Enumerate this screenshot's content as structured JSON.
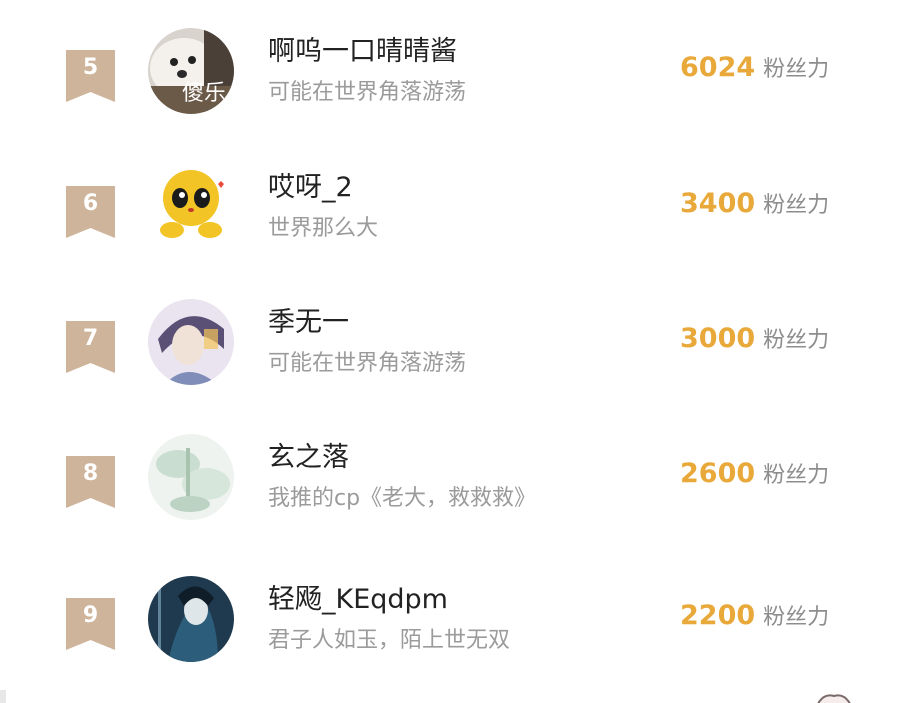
{
  "ranking": {
    "rows": [
      {
        "rank": "5",
        "name": "啊呜一口晴晴酱",
        "bio": "可能在世界角落游荡",
        "fans": "6024",
        "unit": "粉丝力",
        "avatar_overlay": "傻乐"
      },
      {
        "rank": "6",
        "name": "哎呀_2",
        "bio": "世界那么大",
        "fans": "3400",
        "unit": "粉丝力"
      },
      {
        "rank": "7",
        "name": "季无一",
        "bio": "可能在世界角落游荡",
        "fans": "3000",
        "unit": "粉丝力"
      },
      {
        "rank": "8",
        "name": "玄之落",
        "bio": "我推的cp《老大，救救救》",
        "fans": "2600",
        "unit": "粉丝力"
      },
      {
        "rank": "9",
        "name": "轻飏_KEqdpm",
        "bio": "君子人如玉，陌上世无双",
        "fans": "2200",
        "unit": "粉丝力"
      }
    ]
  },
  "colors": {
    "rank_badge": "#cdb49a",
    "fans_value": "#e9a93a",
    "name_text": "#222222",
    "bio_text": "#9b9b9b"
  },
  "icons": {
    "rank_badge": "ribbon-badge-icon"
  }
}
